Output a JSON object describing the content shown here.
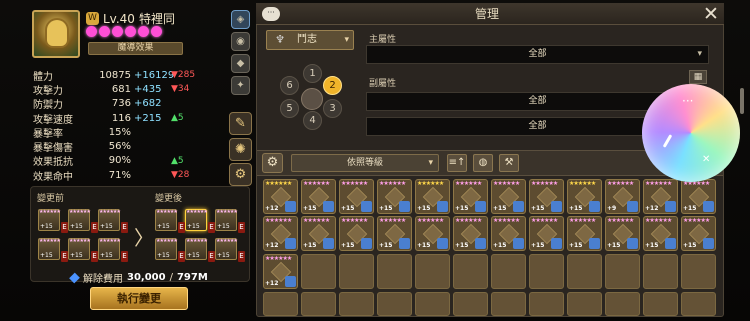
{
  "hero": {
    "level_label": "Lv.40",
    "name": "特裡同",
    "element_glyph": "W",
    "effect_button": "魔導效果",
    "star_count": 6
  },
  "stats": [
    {
      "label": "體力",
      "base": "10875",
      "bonus": "+16129",
      "diff": "285",
      "dir": "down"
    },
    {
      "label": "攻擊力",
      "base": "681",
      "bonus": "+435",
      "diff": "34",
      "dir": "down"
    },
    {
      "label": "防禦力",
      "base": "736",
      "bonus": "+682",
      "diff": "",
      "dir": ""
    },
    {
      "label": "攻擊速度",
      "base": "116",
      "bonus": "+215",
      "diff": "5",
      "dir": "up"
    },
    {
      "label": "暴擊率",
      "base": "15%",
      "bonus": "",
      "diff": "",
      "dir": ""
    },
    {
      "label": "暴擊傷害",
      "base": "56%",
      "bonus": "",
      "diff": "",
      "dir": ""
    },
    {
      "label": "效果抵抗",
      "base": "90%",
      "bonus": "",
      "diff": "5",
      "dir": "up"
    },
    {
      "label": "效果命中",
      "base": "71%",
      "bonus": "",
      "diff": "28",
      "dir": "down"
    }
  ],
  "rune_compare": {
    "before_label": "變更前",
    "after_label": "變更後",
    "arrow": "〉",
    "slot_plus": "+15",
    "tag": "E"
  },
  "cost": {
    "label": "解除費用",
    "value": "30,000",
    "total": "797M"
  },
  "execute_button": "執行變更",
  "manage": {
    "title": "管理",
    "chat_icon": "···",
    "close": "✕"
  },
  "rune_set": {
    "selected": "鬥志",
    "caret": "▾"
  },
  "slots": [
    "1",
    "2",
    "3",
    "4",
    "5",
    "6"
  ],
  "selected_slot": "2",
  "filters": [
    {
      "label": "主屬性",
      "value": "全部"
    },
    {
      "label": "副屬性",
      "value": "全部"
    },
    {
      "label": "",
      "value": "全部"
    },
    {
      "label": "",
      "value": "全部"
    }
  ],
  "sort": {
    "value": "依照等級",
    "caret": "▾"
  },
  "tools": {
    "gear": "⚙",
    "sort_icon": "≡↑",
    "bag_icon": "◍",
    "hammer_icon": "⚒"
  },
  "inventory": {
    "row1": [
      "+12",
      "+15",
      "+15",
      "+15",
      "+15",
      "+15",
      "+15",
      "+15",
      "+15",
      "+9",
      "+12",
      "+15"
    ],
    "row2": [
      "+12",
      "+15",
      "+15",
      "+15",
      "+15",
      "+15",
      "+15",
      "+15",
      "+15",
      "+15",
      "+15",
      "+15"
    ],
    "row3": [
      "+12"
    ]
  },
  "bubble": {
    "dots": "···",
    "mute_icon": "✕"
  }
}
